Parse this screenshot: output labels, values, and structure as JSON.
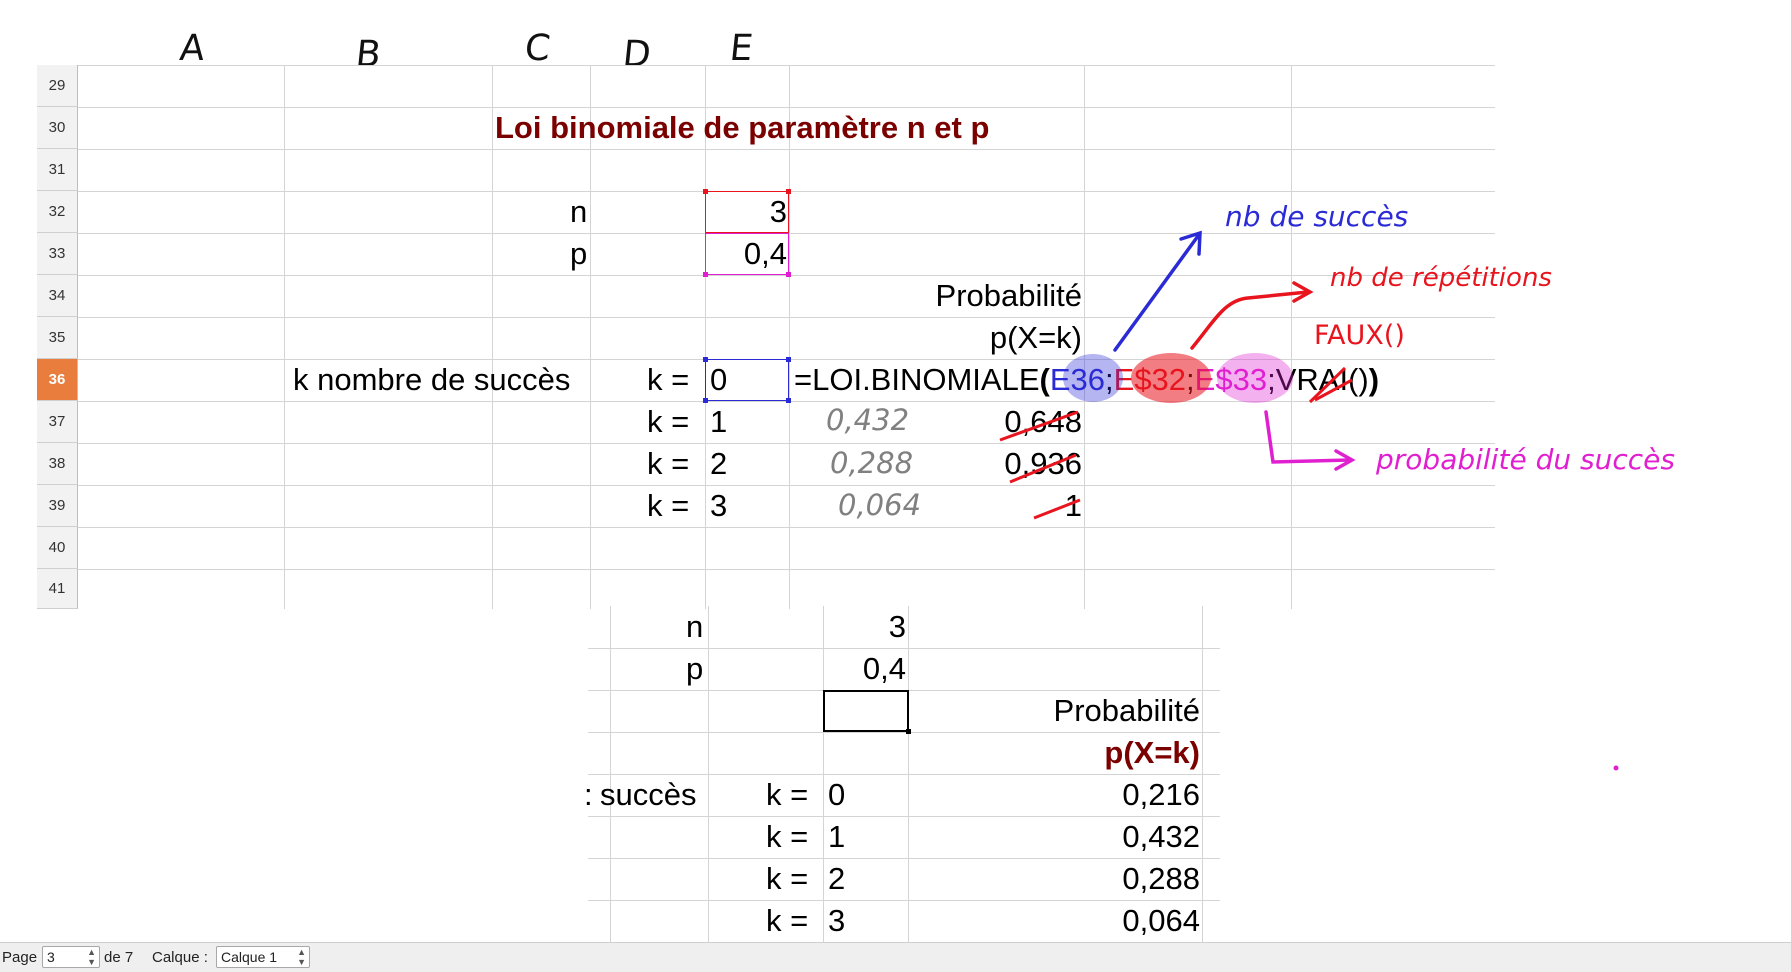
{
  "column_letters": [
    "A",
    "B",
    "C",
    "D",
    "E"
  ],
  "sheet": {
    "row_numbers": [
      "29",
      "30",
      "31",
      "32",
      "33",
      "34",
      "35",
      "36",
      "37",
      "38",
      "39",
      "40",
      "41"
    ],
    "active_row": "36",
    "title": "Loi binomiale de paramètre n et p",
    "n_label": "n",
    "n_value": "3",
    "p_label": "p",
    "p_value": "0,4",
    "prob_header_1": "Probabilité",
    "prob_header_2": "p(X=k)",
    "k_caption": "k nombre de succès",
    "k_rows": [
      {
        "label": "k =",
        "value": "0"
      },
      {
        "label": "k =",
        "value": "1"
      },
      {
        "label": "k =",
        "value": "2"
      },
      {
        "label": "k =",
        "value": "3"
      }
    ],
    "formula": {
      "start": "=LOI.BINOMIALE",
      "open_paren": "(",
      "ref1": "E36",
      "sep1": ";",
      "ref2": "E$32",
      "sep2": ";",
      "ref3": "E$33",
      "sep3": ";",
      "last_arg": "VRAI()",
      "close_paren": ")"
    },
    "crossed_values": [
      "0,648",
      "0,936",
      "1"
    ]
  },
  "annotations": {
    "handwritten_values": [
      "0,432",
      "0,288",
      "0,064"
    ],
    "nb_succes": "nb de succès",
    "nb_repetitions": "nb de répétitions",
    "faux": "FAUX()",
    "proba_succes": "probabilité du succès",
    "colors": {
      "blue": "#2b2bd6",
      "red": "#e8141e",
      "magenta": "#e020d0",
      "gray": "#808080"
    }
  },
  "table2": {
    "n_label": "n",
    "n_value": "3",
    "p_label": "p",
    "p_value": "0,4",
    "prob_header_1": "Probabilité",
    "prob_header_2": "p(X=k)",
    "k_caption": "succès",
    "k_caption_cut": ":",
    "rows": [
      {
        "label": "k =",
        "k": "0",
        "prob": "0,216"
      },
      {
        "label": "k =",
        "k": "1",
        "prob": "0,432"
      },
      {
        "label": "k =",
        "k": "2",
        "prob": "0,288"
      },
      {
        "label": "k =",
        "k": "3",
        "prob": "0,064"
      }
    ]
  },
  "statusbar": {
    "page_label": "Page",
    "page_value": "3",
    "of_label": "de 7",
    "layer_label": "Calque :",
    "layer_value": "Calque 1"
  }
}
